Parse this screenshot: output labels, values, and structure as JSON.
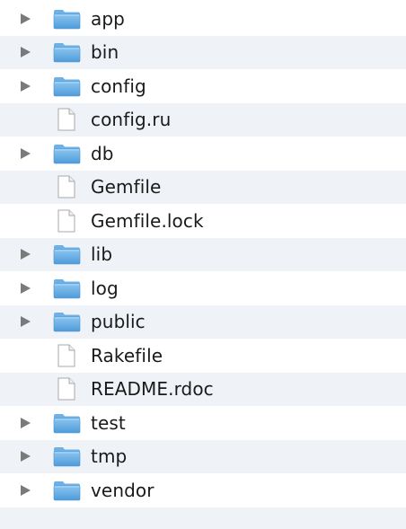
{
  "colors": {
    "stripe": "#eff2f6",
    "folder": "#5ea9e3",
    "disclosure": "#7a7a7a"
  },
  "items": [
    {
      "name": "app",
      "kind": "folder",
      "icon": "folder-icon"
    },
    {
      "name": "bin",
      "kind": "folder",
      "icon": "folder-icon"
    },
    {
      "name": "config",
      "kind": "folder",
      "icon": "folder-icon"
    },
    {
      "name": "config.ru",
      "kind": "file",
      "icon": "document-icon"
    },
    {
      "name": "db",
      "kind": "folder",
      "icon": "folder-icon"
    },
    {
      "name": "Gemfile",
      "kind": "file",
      "icon": "document-icon"
    },
    {
      "name": "Gemfile.lock",
      "kind": "file",
      "icon": "document-icon"
    },
    {
      "name": "lib",
      "kind": "folder",
      "icon": "folder-icon"
    },
    {
      "name": "log",
      "kind": "folder",
      "icon": "folder-icon"
    },
    {
      "name": "public",
      "kind": "folder",
      "icon": "folder-icon"
    },
    {
      "name": "Rakefile",
      "kind": "file",
      "icon": "document-icon"
    },
    {
      "name": "README.rdoc",
      "kind": "file",
      "icon": "document-icon"
    },
    {
      "name": "test",
      "kind": "folder",
      "icon": "folder-icon"
    },
    {
      "name": "tmp",
      "kind": "folder",
      "icon": "folder-icon"
    },
    {
      "name": "vendor",
      "kind": "folder",
      "icon": "folder-icon"
    }
  ]
}
